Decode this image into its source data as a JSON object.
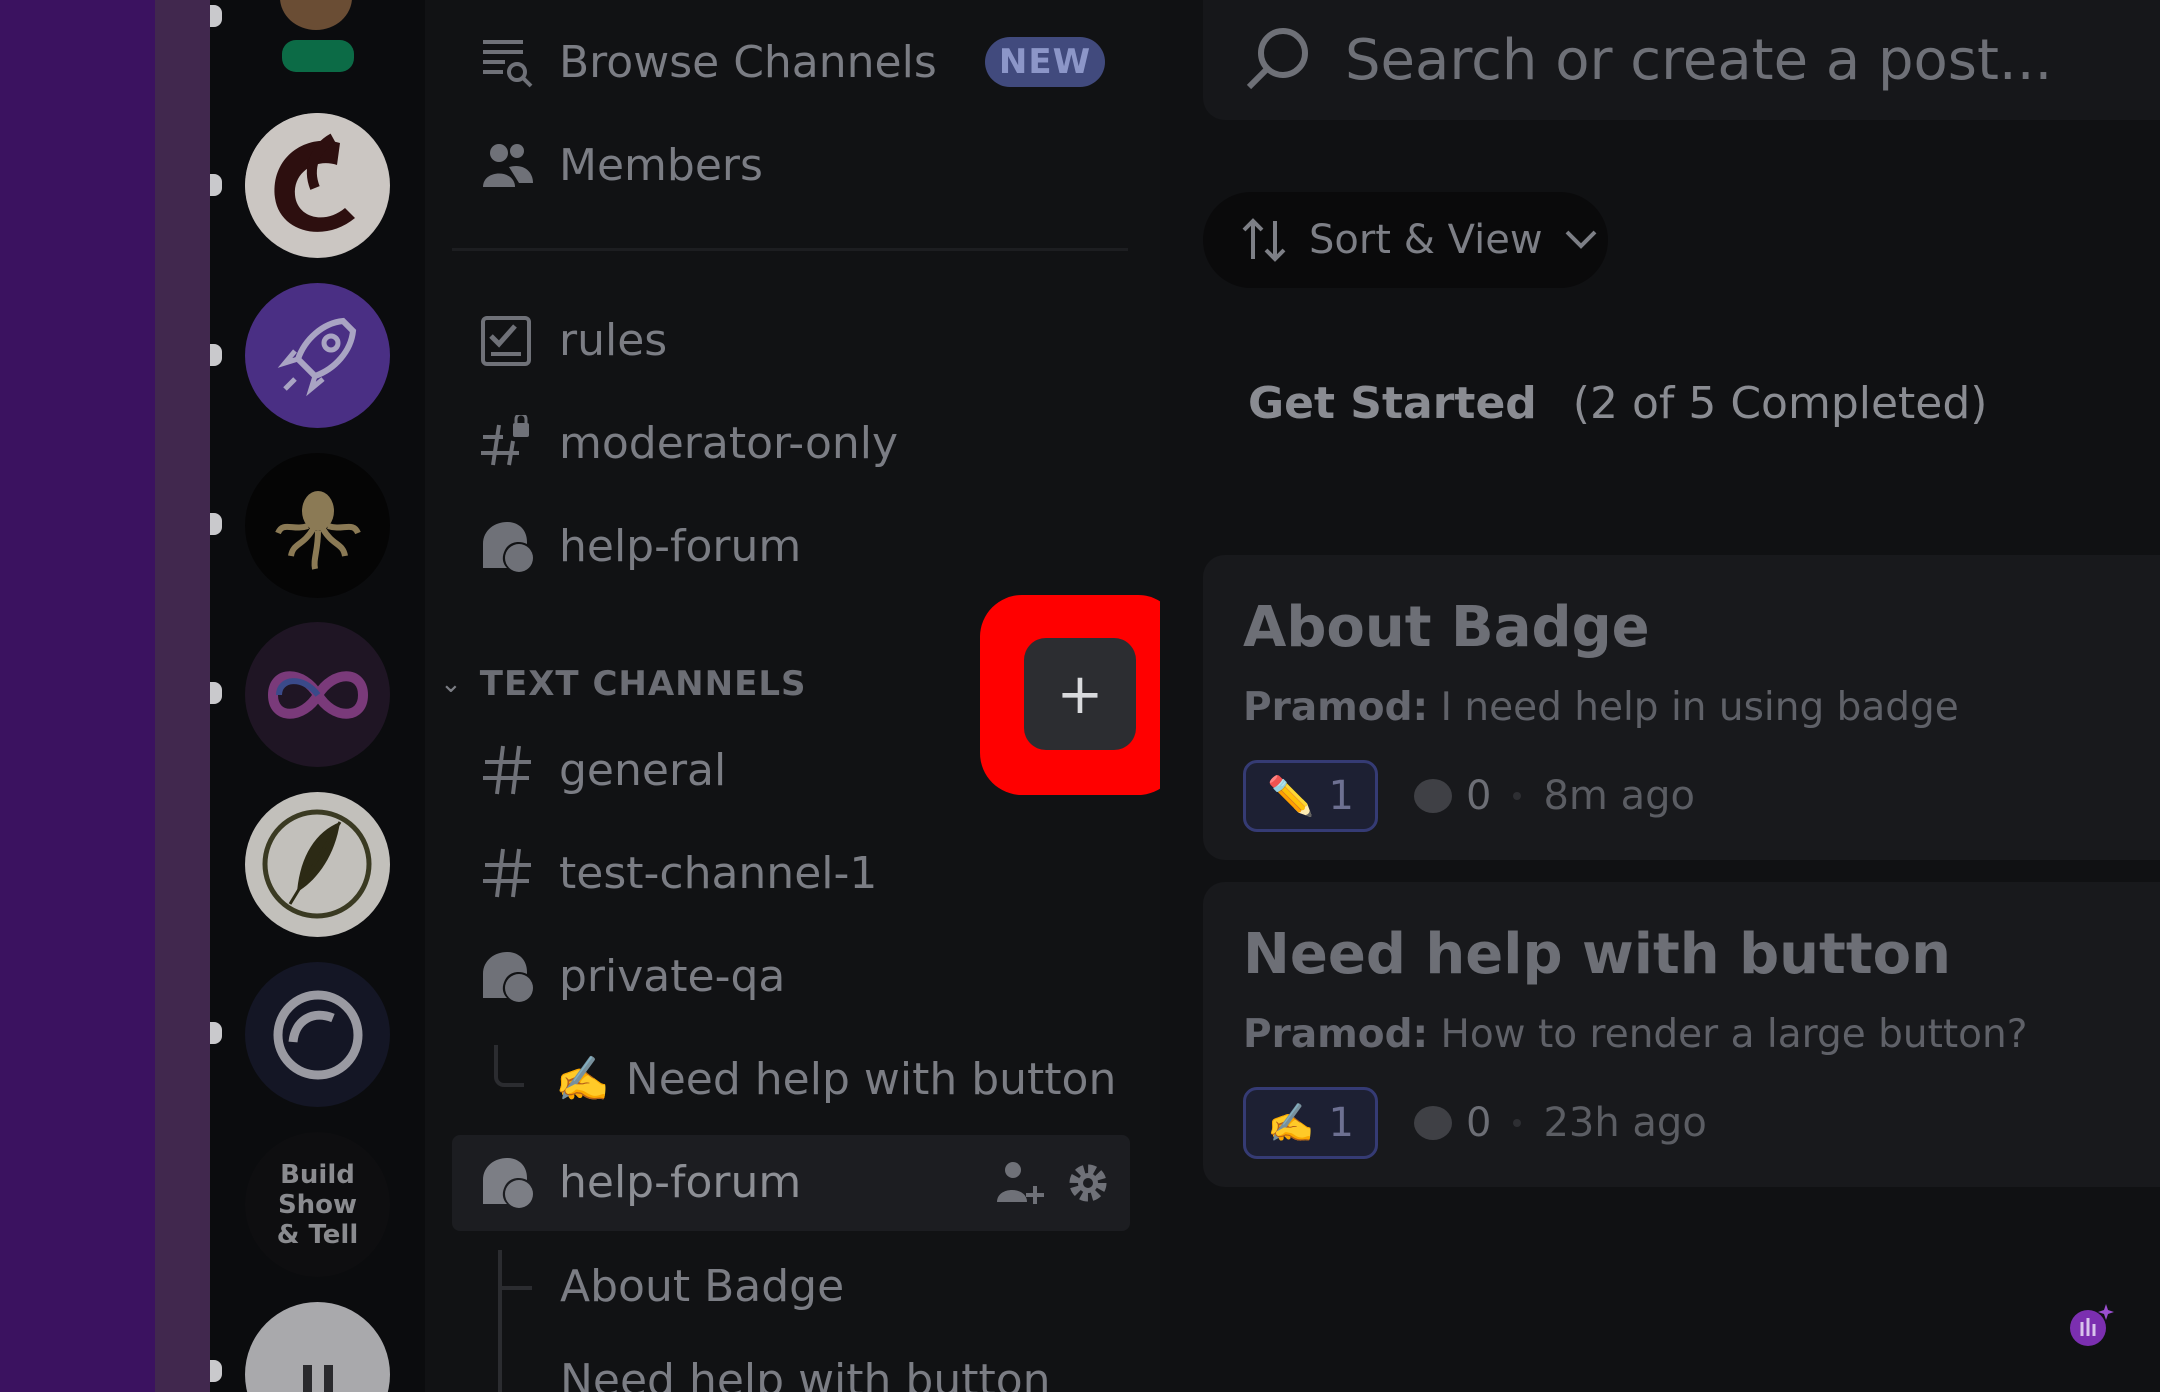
{
  "channel_list": {
    "browse": {
      "label": "Browse Channels",
      "badge": "NEW"
    },
    "members": {
      "label": "Members"
    },
    "channels": [
      {
        "label": "rules",
        "icon": "rules-checklist-icon"
      },
      {
        "label": "moderator-only",
        "icon": "locked-hash-icon"
      },
      {
        "label": "help-forum",
        "icon": "forum-icon"
      }
    ],
    "category": {
      "label": "TEXT CHANNELS"
    },
    "text_channels": [
      {
        "label": "general",
        "icon": "hash-icon"
      },
      {
        "label": "test-channel-1",
        "icon": "hash-icon"
      },
      {
        "label": "private-qa",
        "icon": "forum-icon"
      }
    ],
    "thread": {
      "emoji": "✍️",
      "label": "Need help with button"
    },
    "selected": {
      "label": "help-forum"
    },
    "sub_threads": [
      {
        "label": "About Badge"
      },
      {
        "label": "Need help with button"
      }
    ]
  },
  "add_button": {
    "label": "+"
  },
  "servers": [
    {
      "name": "Build Show & Tell",
      "lines": [
        "Build",
        "Show",
        "& Tell"
      ]
    }
  ],
  "main": {
    "search": {
      "placeholder": "Search or create a post..."
    },
    "sort": {
      "label": "Sort & View"
    },
    "get_started": {
      "title": "Get Started",
      "progress": "(2 of 5 Completed)"
    },
    "posts": [
      {
        "title": "About Badge",
        "author": "Pramod:",
        "preview": " I need help in using badge",
        "reaction_emoji": "✏️",
        "reaction_count": "1",
        "comments": "0",
        "time": "8m ago"
      },
      {
        "title": "Need help with button",
        "author": "Pramod:",
        "preview": " How to render a large button?",
        "reaction_emoji": "✍️",
        "reaction_count": "1",
        "comments": "0",
        "time": "23h ago"
      }
    ]
  },
  "colors": {
    "highlight": "#ff0000",
    "new_badge": "#414a7d",
    "purple_edge": "#3b1260"
  }
}
